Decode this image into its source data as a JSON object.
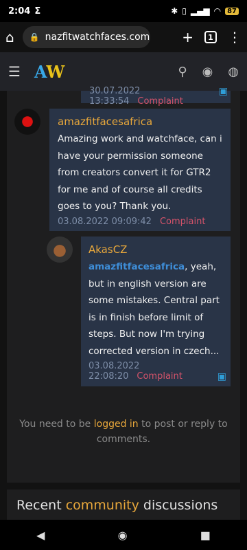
{
  "status": {
    "time": "2:04",
    "sigma": "Σ",
    "battery": "87"
  },
  "browser": {
    "url": "nazfitwatchfaces.com",
    "tab_count": "1"
  },
  "site": {
    "logo_a": "A",
    "logo_w": "W"
  },
  "comments": [
    {
      "date": "30.07.2022 13:33:54",
      "complaint": "Complaint"
    },
    {
      "author": "amazfitfacesafrica",
      "text": "Amazing work and watchface, can i have your permission someone from creators convert it for GTR2 for me and of course all credits goes to you? Thank you.",
      "date": "03.08.2022 09:09:42",
      "complaint": "Complaint"
    },
    {
      "author": "AkasCZ",
      "mention": "amazfitfacesafrica",
      "text": ", yeah, but in english version are some mistakes. Central part is in finish before limit of steps. But now I'm trying corrected version in czech...",
      "date": "03.08.2022 22:08:20",
      "complaint": "Complaint"
    }
  ],
  "login": {
    "prefix": "You need to be ",
    "link": "logged in",
    "suffix": " to post or reply to comments."
  },
  "recent": {
    "prefix": "Recent ",
    "highlight": "community",
    "suffix": " discussions"
  }
}
